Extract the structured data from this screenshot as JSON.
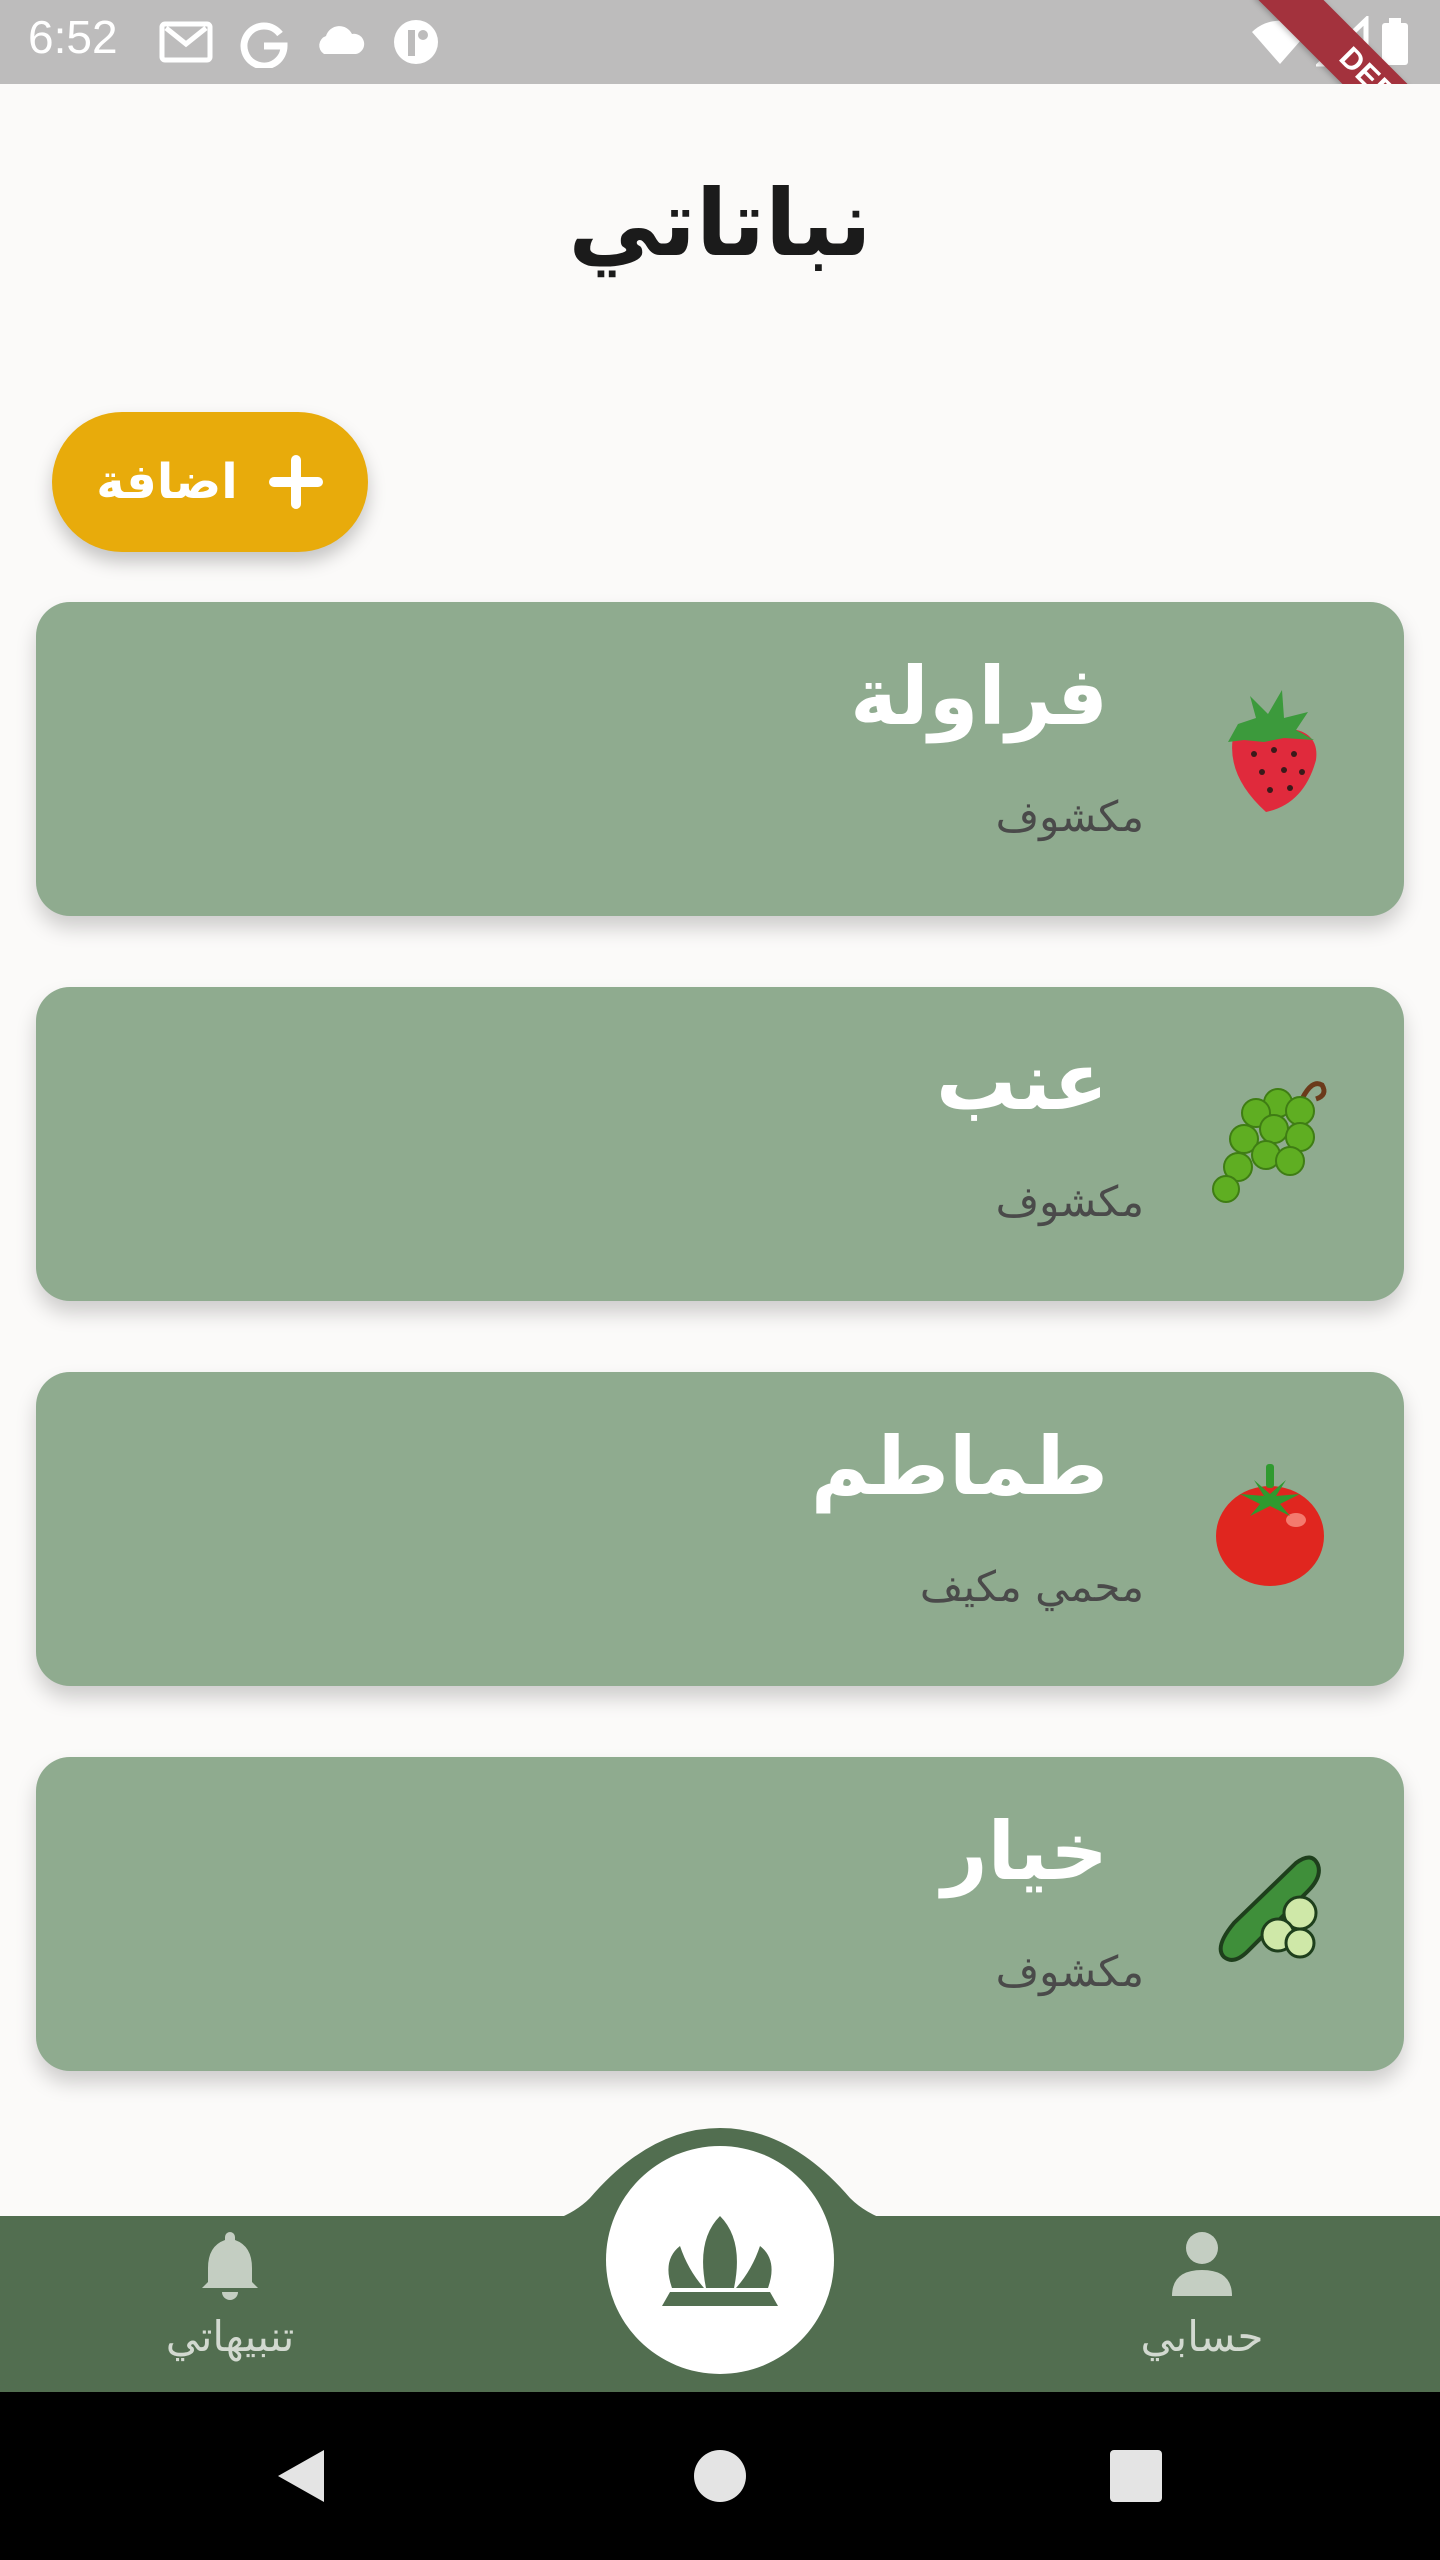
{
  "status_bar": {
    "time": "6:52",
    "icons": [
      "gmail-icon",
      "google-icon",
      "cloud-icon",
      "app-icon",
      "wifi-icon",
      "signal-icon",
      "battery-icon"
    ],
    "debug_label": "DEBUG"
  },
  "page": {
    "title": "نباتاتي"
  },
  "add_button": {
    "label": "اضافة",
    "icon": "plus-icon",
    "color": "#e8ab0b"
  },
  "plants": [
    {
      "name": "فراولة",
      "status": "مكشوف",
      "icon": "strawberry-icon"
    },
    {
      "name": "عنب",
      "status": "مكشوف",
      "icon": "grapes-icon"
    },
    {
      "name": "طماطم",
      "status": "محمي مكيف",
      "icon": "tomato-icon"
    },
    {
      "name": "خيار",
      "status": "مكشوف",
      "icon": "cucumber-icon"
    }
  ],
  "card_color": "#8fab8f",
  "bottom_nav": {
    "color": "#526e50",
    "notifications": {
      "label": "تنبيهاتي",
      "icon": "bell-icon"
    },
    "center": {
      "icon": "plant-logo-icon"
    },
    "account": {
      "label": "حسابي",
      "icon": "person-icon"
    }
  },
  "system_nav": {
    "buttons": [
      "back-icon",
      "home-icon",
      "recents-icon"
    ]
  }
}
